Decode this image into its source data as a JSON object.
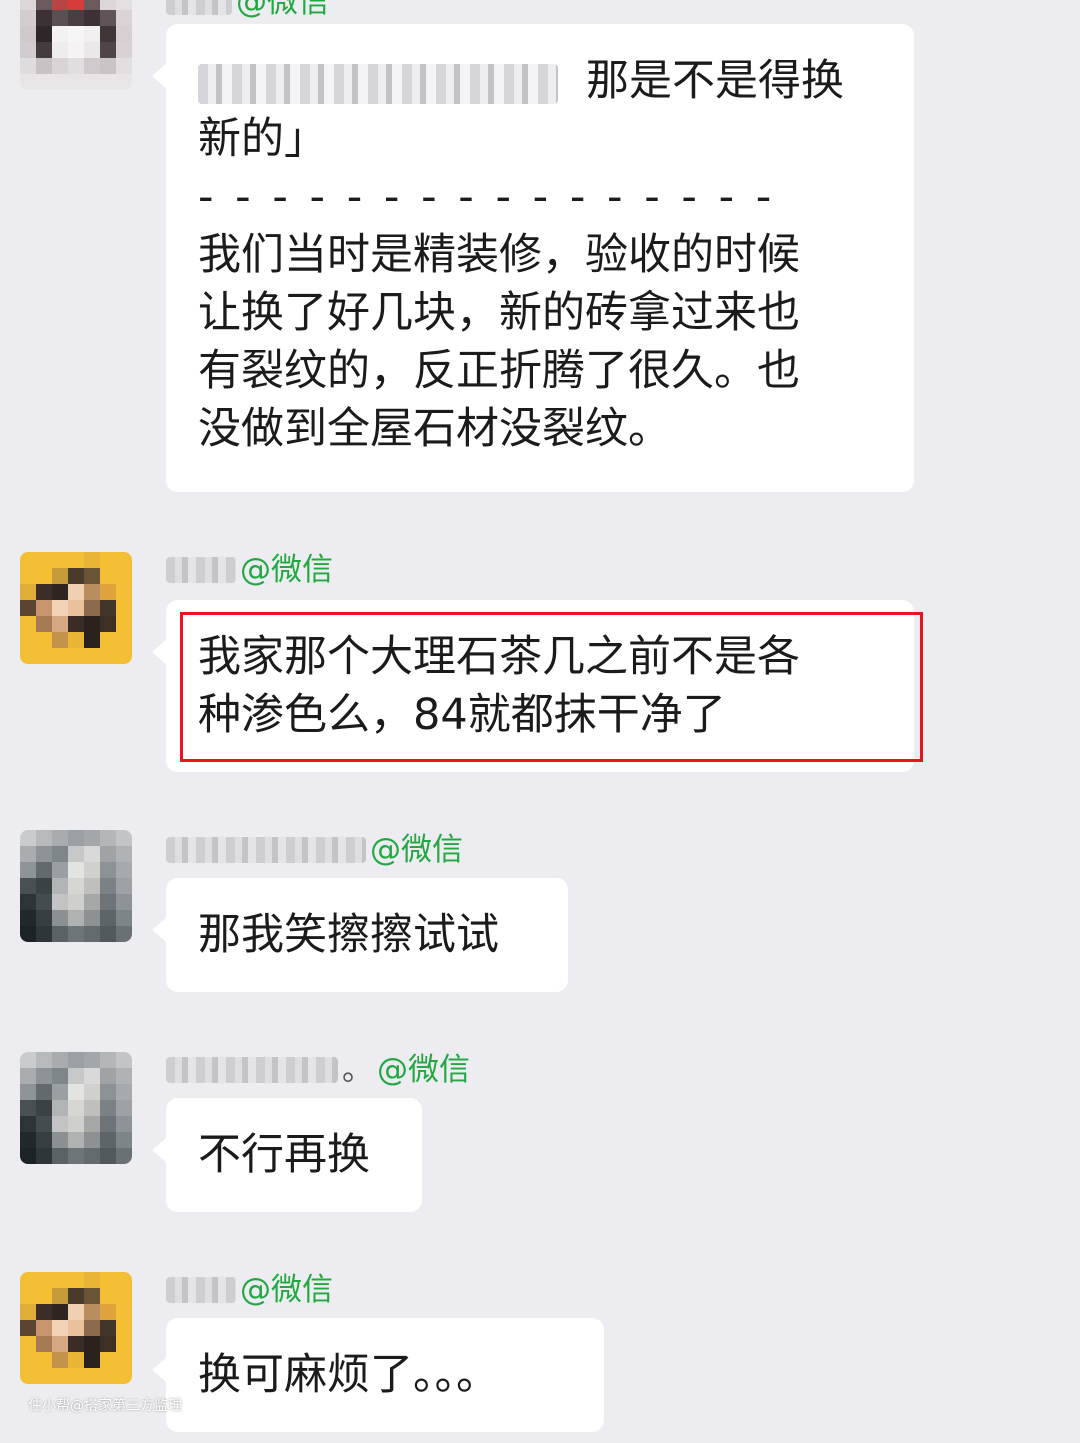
{
  "colors": {
    "background": "#ededf1",
    "bubble": "#ffffff",
    "source_tag": "#22a842",
    "highlight_border": "#e8141e"
  },
  "messages": [
    {
      "source_tag": "@微信",
      "lines": [
        "那是不是得换",
        "新的」",
        "- - - - - - - - - - - - - - - -",
        "我们当时是精装修，验收的时候",
        "让换了好几块，新的砖拿过来也",
        "有裂纹的，反正折腾了很久。也",
        "没做到全屋石材没裂纹。"
      ]
    },
    {
      "source_tag": "@微信",
      "lines": [
        "我家那个大理石茶几之前不是各",
        "种渗色么，84就都抹干净了"
      ]
    },
    {
      "source_tag": "@微信",
      "lines": [
        "那我笑擦擦试试"
      ]
    },
    {
      "name_suffix": "。",
      "source_tag": "@微信",
      "lines": [
        "不行再换"
      ]
    },
    {
      "source_tag": "@微信",
      "lines": [
        "换可麻烦了。。。"
      ]
    }
  ],
  "watermark": "住小帮@搭家第三方监理"
}
